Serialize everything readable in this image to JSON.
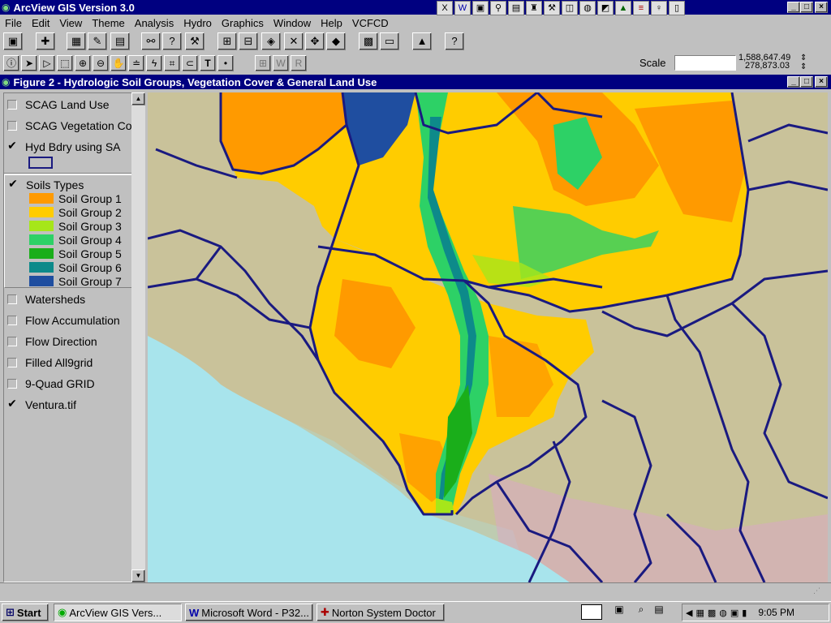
{
  "app": {
    "title": "ArcView GIS Version 3.0"
  },
  "menu": [
    "File",
    "Edit",
    "View",
    "Theme",
    "Analysis",
    "Hydro",
    "Graphics",
    "Window",
    "Help",
    "VCFCD"
  ],
  "toolbar": {
    "scale_label": "Scale",
    "scale_value": "",
    "coord_x": "1,588,647.49",
    "coord_y": "278,873.03"
  },
  "view": {
    "title": "Figure 2 - Hydrologic Soil Groups, Vegetation Cover & General Land Use"
  },
  "legend": {
    "themes_top": [
      {
        "label": "SCAG Land Use",
        "checked": false
      },
      {
        "label": "SCAG Vegetation Cover",
        "checked": false
      },
      {
        "label": "Hyd Bdry using SA",
        "checked": true
      }
    ],
    "soils": {
      "label": "Soils Types",
      "checked": true,
      "classes": [
        {
          "label": "Soil Group 1",
          "color": "#ff9a00"
        },
        {
          "label": "Soil Group 2",
          "color": "#ffcc00"
        },
        {
          "label": "Soil Group 3",
          "color": "#a6e61a"
        },
        {
          "label": "Soil Group 4",
          "color": "#2dd166"
        },
        {
          "label": "Soil Group 5",
          "color": "#1aae1a"
        },
        {
          "label": "Soil Group 6",
          "color": "#0d8a8a"
        },
        {
          "label": "Soil Group 7",
          "color": "#1f4ea0"
        }
      ]
    },
    "themes_bottom": [
      {
        "label": "Watersheds",
        "checked": false
      },
      {
        "label": "Flow Accumulation",
        "checked": false
      },
      {
        "label": "Flow Direction",
        "checked": false
      },
      {
        "label": "Filled All9grid",
        "checked": false
      },
      {
        "label": "9-Quad GRID",
        "checked": false
      },
      {
        "label": "Ventura.tif",
        "checked": true
      }
    ]
  },
  "taskbar": {
    "start": "Start",
    "tasks": [
      "ArcView GIS Vers...",
      "Microsoft Word - P32...",
      "Norton System Doctor"
    ],
    "clock": "9:05 PM"
  },
  "colors": {
    "boundary": "#1a1a80",
    "ocean": "#a8e4ec",
    "terrain": "#c9c29a"
  }
}
